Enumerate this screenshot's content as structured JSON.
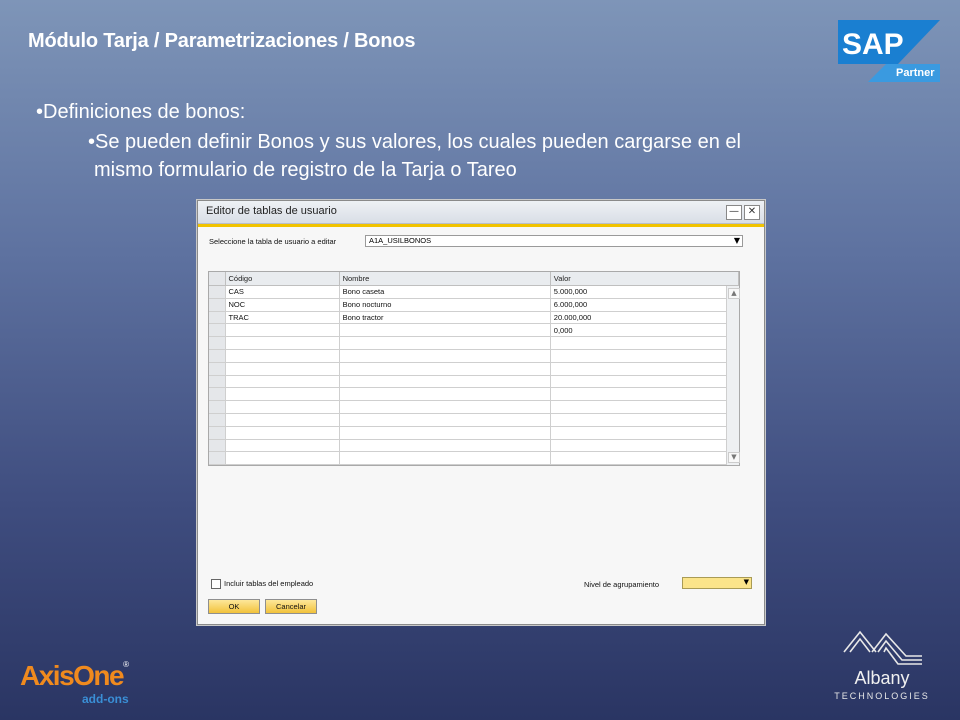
{
  "slide": {
    "title": "Módulo Tarja / Parametrizaciones / Bonos",
    "bullet1": "•Definiciones de bonos:",
    "bullet2_line1": "•Se pueden definir Bonos y sus valores, los cuales pueden cargarse en el",
    "bullet2_line2": "mismo formulario de registro de la Tarja o Tareo"
  },
  "logos": {
    "sap_text": "SAP",
    "sap_partner": "Partner",
    "axis_name": "AxisOne",
    "axis_reg": "®",
    "axis_sub": "add-ons",
    "albany_name": "Albany",
    "albany_sub": "TECHNOLOGIES"
  },
  "window": {
    "title": "Editor de tablas de usuario",
    "minimize_glyph": "—",
    "close_glyph": "✕",
    "select_label": "Seleccione la tabla de usuario a editar",
    "select_value": "A1A_USILBONOS",
    "columns": [
      "Código",
      "Nombre",
      "Valor"
    ],
    "rows": [
      [
        "CAS",
        "Bono caseta",
        "5.000,000"
      ],
      [
        "NOC",
        "Bono nocturno",
        "6.000,000"
      ],
      [
        "TRAC",
        "Bono tractor",
        "20.000,000"
      ],
      [
        "",
        "",
        "0,000"
      ],
      [
        "",
        "",
        ""
      ],
      [
        "",
        "",
        ""
      ],
      [
        "",
        "",
        ""
      ],
      [
        "",
        "",
        ""
      ],
      [
        "",
        "",
        ""
      ],
      [
        "",
        "",
        ""
      ],
      [
        "",
        "",
        ""
      ],
      [
        "",
        "",
        ""
      ],
      [
        "",
        "",
        ""
      ],
      [
        "",
        "",
        ""
      ]
    ],
    "checkbox_label": "Incluir tablas del empleado",
    "level_label": "Nivel de agrupamiento",
    "ok_label": "OK",
    "cancel_label": "Cancelar"
  },
  "colors": {
    "accent_yellow": "#f1c300",
    "sap_blue": "#1a7fd1",
    "axis_orange": "#f08a1e"
  }
}
